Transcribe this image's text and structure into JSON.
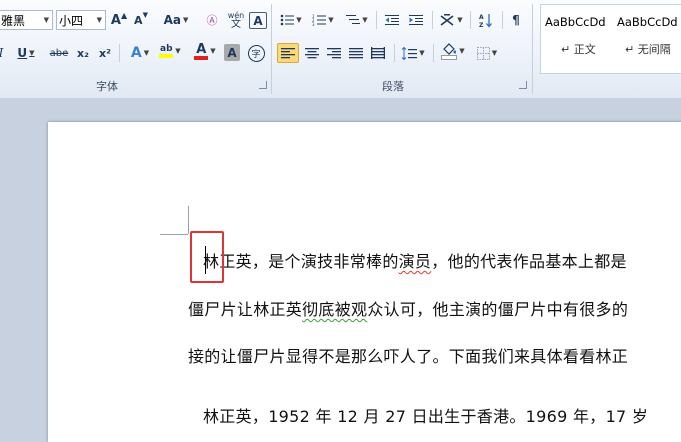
{
  "ribbon": {
    "font_name": "雅黑",
    "font_size": "小四",
    "grow_font": "A",
    "shrink_font": "A",
    "change_case": "Aa",
    "phonetic_guide": "wén",
    "enclose_label": "A",
    "underline": "U",
    "strikethrough": "abe",
    "subscript": "x₂",
    "superscript": "x²",
    "text_effects": "A",
    "highlight": "ab",
    "font_color": "A",
    "char_shading": "A",
    "enclose_char": "字",
    "font_group_label": "字体",
    "paragraph_group_label": "段落",
    "styles": [
      {
        "sample": "AaBbCcDd",
        "name": "↵ 正文"
      },
      {
        "sample": "AaBbCcDd",
        "name": "↵ 无间隔"
      }
    ]
  },
  "document": {
    "line1_pre": "林",
    "line1_post": "正英，是个演技非常棒的",
    "line1_squig": "演员",
    "line1_rest": "，他的代表作品基本上都是",
    "line2_pre": "僵尸片让林正英",
    "line2_squig": "彻底被观",
    "line2_rest": "众认可，他主演的僵尸片中有很多的",
    "line3": "接的让僵尸片显得不是那么吓人了。下面我们来具体看看林正",
    "line4": "林正英，1952 年 12 月 27 日出生于香港。1969 年，17 岁"
  },
  "colors": {
    "accent_highlight": "#fbd978",
    "annotation_red": "#e03434",
    "font_color_bar": "#e0211b",
    "highlight_bar": "#ffff00"
  }
}
